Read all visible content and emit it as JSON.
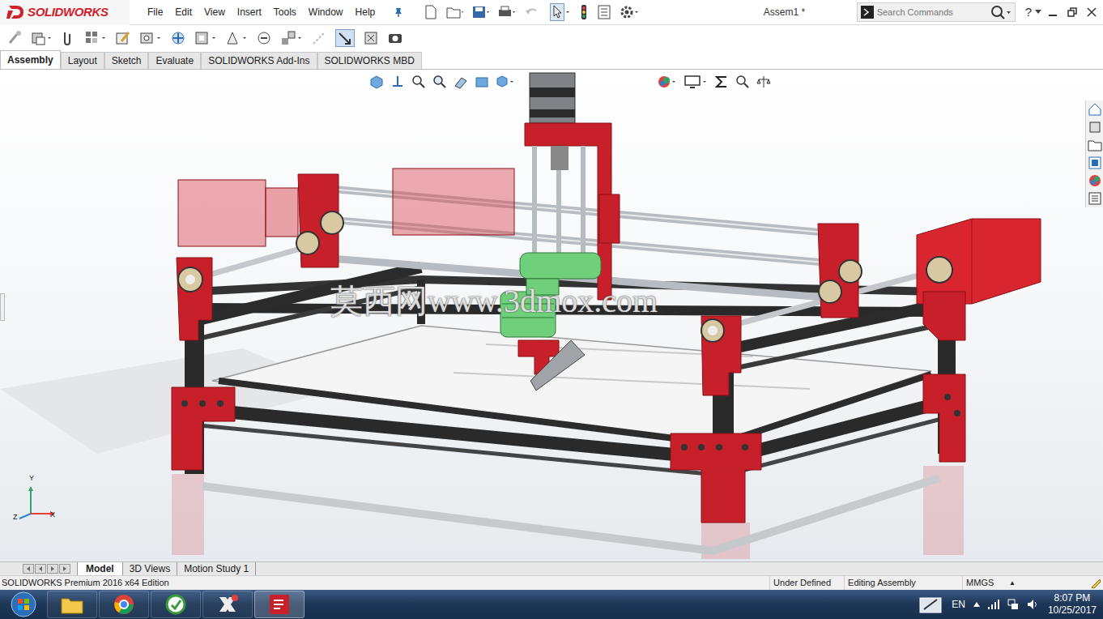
{
  "app": {
    "logo": "SOLIDWORKS",
    "document_title": "Assem1 *"
  },
  "menu": [
    "File",
    "Edit",
    "View",
    "Insert",
    "Tools",
    "Window",
    "Help"
  ],
  "search": {
    "placeholder": "Search Commands"
  },
  "help": "?",
  "command_tabs": [
    {
      "label": "Assembly",
      "selected": true
    },
    {
      "label": "Layout",
      "selected": false
    },
    {
      "label": "Sketch",
      "selected": false
    },
    {
      "label": "Evaluate",
      "selected": false
    },
    {
      "label": "SOLIDWORKS Add-Ins",
      "selected": false
    },
    {
      "label": "SOLIDWORKS MBD",
      "selected": false
    }
  ],
  "viewport": {
    "watermark": "莫西网www.3dmox.com",
    "triad": {
      "y": "Y",
      "z": "Z",
      "x": "X"
    }
  },
  "model_tabs": [
    {
      "label": "Model",
      "selected": true
    },
    {
      "label": "3D Views",
      "selected": false
    },
    {
      "label": "Motion Study 1",
      "selected": false
    }
  ],
  "status_bar": {
    "edition": "SOLIDWORKS Premium 2016 x64 Edition",
    "items": [
      "Under Defined",
      "Editing Assembly",
      "MMGS"
    ],
    "arrow": "▲"
  },
  "taskbar": {
    "language": "EN",
    "time": "8:07 PM",
    "date": "10/25/2017"
  }
}
